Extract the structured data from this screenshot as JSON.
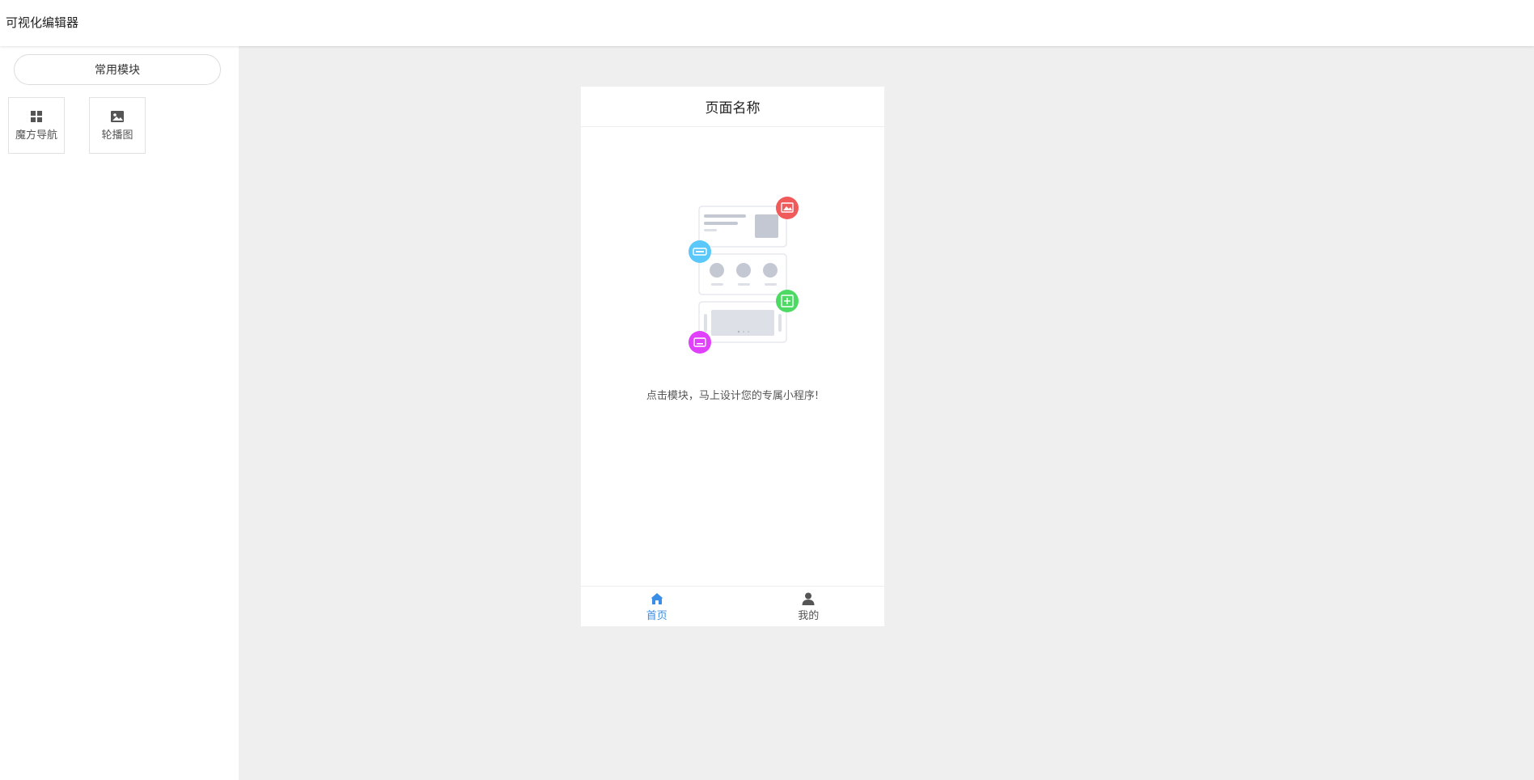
{
  "header": {
    "app_title": "可视化编辑器"
  },
  "sidebar": {
    "tab_label": "常用模块",
    "modules": [
      {
        "label": "魔方导航",
        "icon": "grid-icon"
      },
      {
        "label": "轮播图",
        "icon": "image-icon"
      }
    ]
  },
  "phone": {
    "page_title": "页面名称",
    "hint": "点击模块，马上设计您的专属小程序!",
    "tabbar": [
      {
        "label": "首页",
        "icon": "home-icon",
        "active": true
      },
      {
        "label": "我的",
        "icon": "user-icon",
        "active": false
      }
    ]
  },
  "colors": {
    "accent": "#3a8ee6",
    "canvas_bg": "#efefef",
    "badge_red": "#f15a5a",
    "badge_blue": "#5ac8fa",
    "badge_green": "#4cd964",
    "badge_magenta": "#e040fb"
  }
}
